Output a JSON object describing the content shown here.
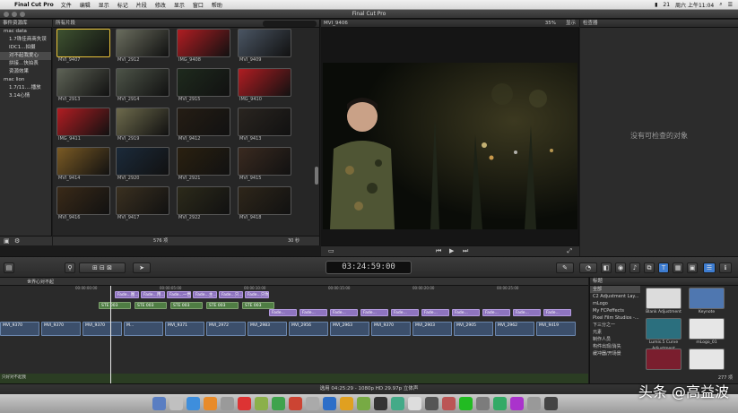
{
  "menubar": {
    "app_name": "Final Cut Pro",
    "items": [
      "文件",
      "编辑",
      "显示",
      "标记",
      "片段",
      "修改",
      "显示",
      "窗口",
      "帮助"
    ],
    "clock": "周六 上午11:04",
    "battery": "21"
  },
  "window": {
    "title": "Final Cut Pro"
  },
  "library": {
    "header": "事件资源库",
    "rows": [
      {
        "label": "mac data",
        "indent": false,
        "selected": false
      },
      {
        "label": "1.7珠佳商商失误",
        "indent": true,
        "selected": false
      },
      {
        "label": "IDC1...拍摄",
        "indent": true,
        "selected": false
      },
      {
        "label": "对不起我爱心",
        "indent": true,
        "selected": true
      },
      {
        "label": "拼接...快拍表",
        "indent": true,
        "selected": false
      },
      {
        "label": "资源效果",
        "indent": true,
        "selected": false
      },
      {
        "label": "mac lion",
        "indent": false,
        "selected": false
      },
      {
        "label": "1.7/11....播放",
        "indent": true,
        "selected": false
      },
      {
        "label": "3.14心情",
        "indent": true,
        "selected": false
      }
    ]
  },
  "browser": {
    "header": "所有片段",
    "count_label": "576 项",
    "duration_label": "30 秒",
    "clips": [
      {
        "name": "MVI_9407",
        "color": "#3e5230"
      },
      {
        "name": "MVI_2912",
        "color": "#6a6d5e"
      },
      {
        "name": "IMG_9408",
        "color": "#b01d22"
      },
      {
        "name": "MVI_9409",
        "color": "#4a5563"
      },
      {
        "name": "MVI_2913",
        "color": "#5e6356"
      },
      {
        "name": "MVI_2914",
        "color": "#4d5448"
      },
      {
        "name": "MVI_2915",
        "color": "#1e2a1d"
      },
      {
        "name": "IMG_9410",
        "color": "#b01d22"
      },
      {
        "name": "IMG_9411",
        "color": "#b01d22"
      },
      {
        "name": "MVI_2919",
        "color": "#6d6a4c"
      },
      {
        "name": "MVI_9412",
        "color": "#251d14"
      },
      {
        "name": "MVI_9413",
        "color": "#2a2520"
      },
      {
        "name": "MVI_9414",
        "color": "#7a5a24"
      },
      {
        "name": "MVI_2920",
        "color": "#1b2a3a"
      },
      {
        "name": "MVI_2921",
        "color": "#2a2010"
      },
      {
        "name": "MVI_9415",
        "color": "#3a2a20"
      },
      {
        "name": "MVI_9416",
        "color": "#3a2a18"
      },
      {
        "name": "MVI_9417",
        "color": "#3a3020"
      },
      {
        "name": "MVI_2922",
        "color": "#2c2a1a"
      },
      {
        "name": "MVI_9418",
        "color": "#2e261a"
      }
    ]
  },
  "viewer": {
    "clip_name": "MVI_9406",
    "zoom": "35%",
    "view_menu": "显示"
  },
  "inspector": {
    "header": "检查器",
    "empty_message": "没有可检查的对象"
  },
  "toolbar": {
    "timecode": "03:24:59:00"
  },
  "timeline": {
    "project_name": "世界心对不起",
    "ruler": [
      "00:00:00:00",
      "00:00:05:00",
      "00:00:10:00",
      "00:00:15:00",
      "00:00:20:00",
      "00:00:25:00"
    ],
    "purple_clips": [
      "Fade...图...",
      "Fade...用...",
      "Fade...一世走...",
      "Fade...主...",
      "Fade...只...",
      "Fade...只你..."
    ],
    "lower_purple_clips": [
      "Fade...",
      "Fade...",
      "Fade...",
      "Fade...",
      "Fade...",
      "Fade...",
      "Fade...",
      "Fade...",
      "Fade...",
      "Fade..."
    ],
    "green_clips": [
      "STE 003",
      "STE 003",
      "STE 003",
      "STE 003",
      "STE 003"
    ],
    "video_clips": [
      "MVI_9370",
      "MVI_9370",
      "MVI_9370",
      "M...",
      "MVI_9371",
      "MVI_2972",
      "MVI_2983",
      "MVI_2956",
      "MVI_2963",
      "MVI_9370",
      "MVI_2903",
      "MVI_2905",
      "MVI_2962",
      "MVI_9419"
    ],
    "audio_label": "只好对不起我"
  },
  "effects": {
    "header": "标题",
    "categories": [
      {
        "label": "全部",
        "selected": true
      },
      {
        "label": "C2 Adjustment Lay...",
        "selected": false
      },
      {
        "label": "mLogo",
        "selected": false
      },
      {
        "label": "My FCPeffects",
        "selected": false
      },
      {
        "label": "Pixel Film Studios -...",
        "selected": false
      },
      {
        "label": "下三分之一",
        "selected": false
      },
      {
        "label": "元素",
        "selected": false
      },
      {
        "label": "制作人员",
        "selected": false
      },
      {
        "label": "构件出现/消失",
        "selected": false
      },
      {
        "label": "缓冲器/开场景",
        "selected": false
      }
    ],
    "items": [
      {
        "name": "Blank Adjustment",
        "color": "#dcdcdc"
      },
      {
        "name": "Keynote",
        "color": "#4f77b0"
      },
      {
        "name": "Lumis.5 Curve Adjustment",
        "color": "#2b6f7e"
      },
      {
        "name": "mLogo_01",
        "color": "#e6e6e6"
      },
      {
        "name": "",
        "color": "#7a1e2e"
      },
      {
        "name": "",
        "color": "#e6e6e6"
      }
    ],
    "count_label": "277 项"
  },
  "status": {
    "text": "选用 04:25:29 - 1080p HD 29.97p 立体声"
  },
  "watermark": "头条 @高益波"
}
